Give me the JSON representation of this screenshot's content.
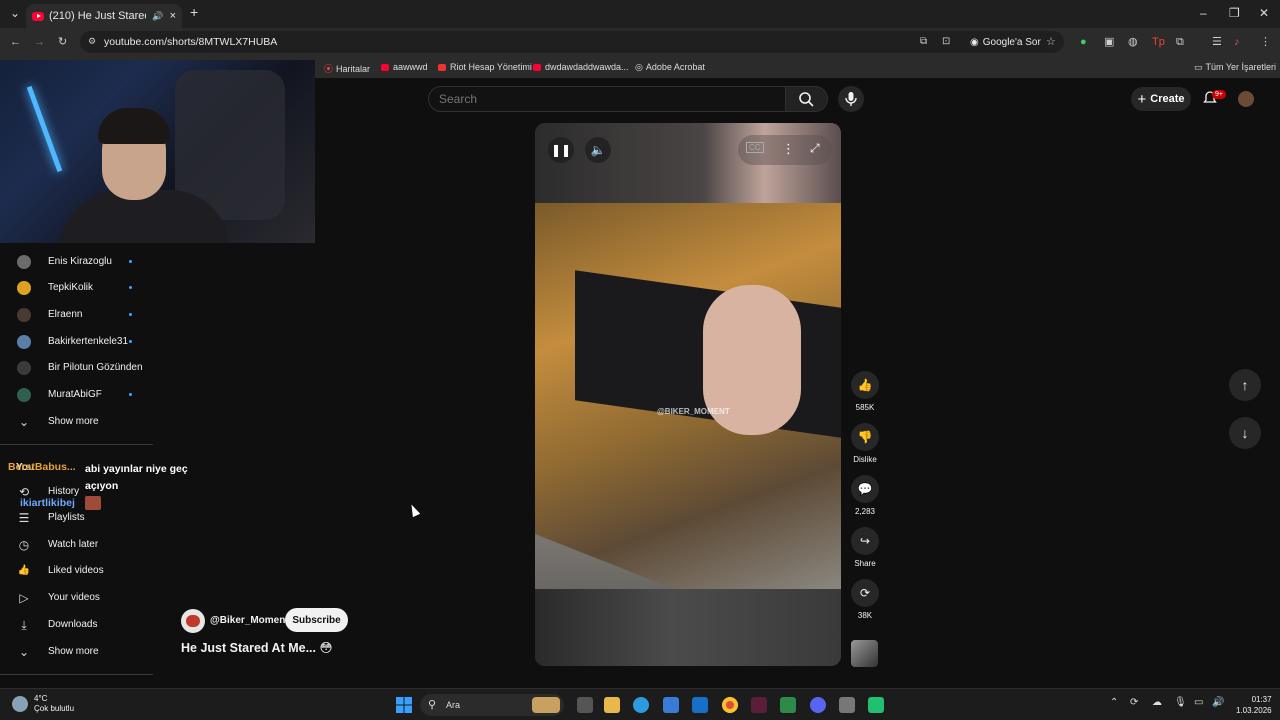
{
  "browser": {
    "tab_title": "(210) He Just Stared At Me...",
    "url": "youtube.com/shorts/8MTWLX7HUBA",
    "ask_google": "Google'a Sor",
    "bookmarks": [
      "Haritalar",
      "aawwwd",
      "Riot Hesap Yönetimi",
      "dwdawdaddwawda...",
      "Adobe Acrobat"
    ],
    "all_bookmarks": "Tüm Yer İşaretleri"
  },
  "youtube": {
    "search_placeholder": "Search",
    "create_label": "Create",
    "notif_badge": "9+",
    "subscriptions": [
      {
        "name": "Enis Kirazoglu",
        "color": "#6b6b6b"
      },
      {
        "name": "TepkiKolik",
        "color": "#e0a020"
      },
      {
        "name": "Elraenn",
        "color": "#4a3a33"
      },
      {
        "name": "Bakirkertenkele31",
        "color": "#5a7fa6"
      },
      {
        "name": "Bir Pilotun Gözünden",
        "color": "#3b3b3b"
      },
      {
        "name": "MuratAbiGF",
        "color": "#2f5f4f"
      }
    ],
    "show_more": "Show more",
    "you_section": "You",
    "you_items": [
      {
        "label": "History",
        "icon": "history-icon",
        "glyph": "⟲"
      },
      {
        "label": "Playlists",
        "icon": "playlists-icon",
        "glyph": "☰"
      },
      {
        "label": "Watch later",
        "icon": "clock-icon",
        "glyph": "◷"
      },
      {
        "label": "Liked videos",
        "icon": "thumbs-up-icon",
        "glyph": "👍"
      },
      {
        "label": "Your videos",
        "icon": "video-icon",
        "glyph": "▷"
      },
      {
        "label": "Downloads",
        "icon": "download-icon",
        "glyph": "⤓"
      }
    ],
    "short": {
      "watermark": "@BIKER_MOMENT",
      "channel": "@Biker_Moment",
      "subscribe": "Subscribe",
      "title": "He Just Stared At Me... 😳",
      "likes": "585K",
      "dislike": "Dislike",
      "comments": "2,283",
      "share": "Share",
      "remix": "38K"
    }
  },
  "stream_chat": [
    {
      "user": "BeratBabus...",
      "message": "abi yayınlar niye geç açıyon"
    },
    {
      "user": "ikiartlikibej",
      "message": ""
    }
  ],
  "taskbar": {
    "weather_temp": "4°C",
    "weather_desc": "Çok bulutlu",
    "search": "Ara",
    "time": "01:37",
    "date": "1.03.2026"
  }
}
